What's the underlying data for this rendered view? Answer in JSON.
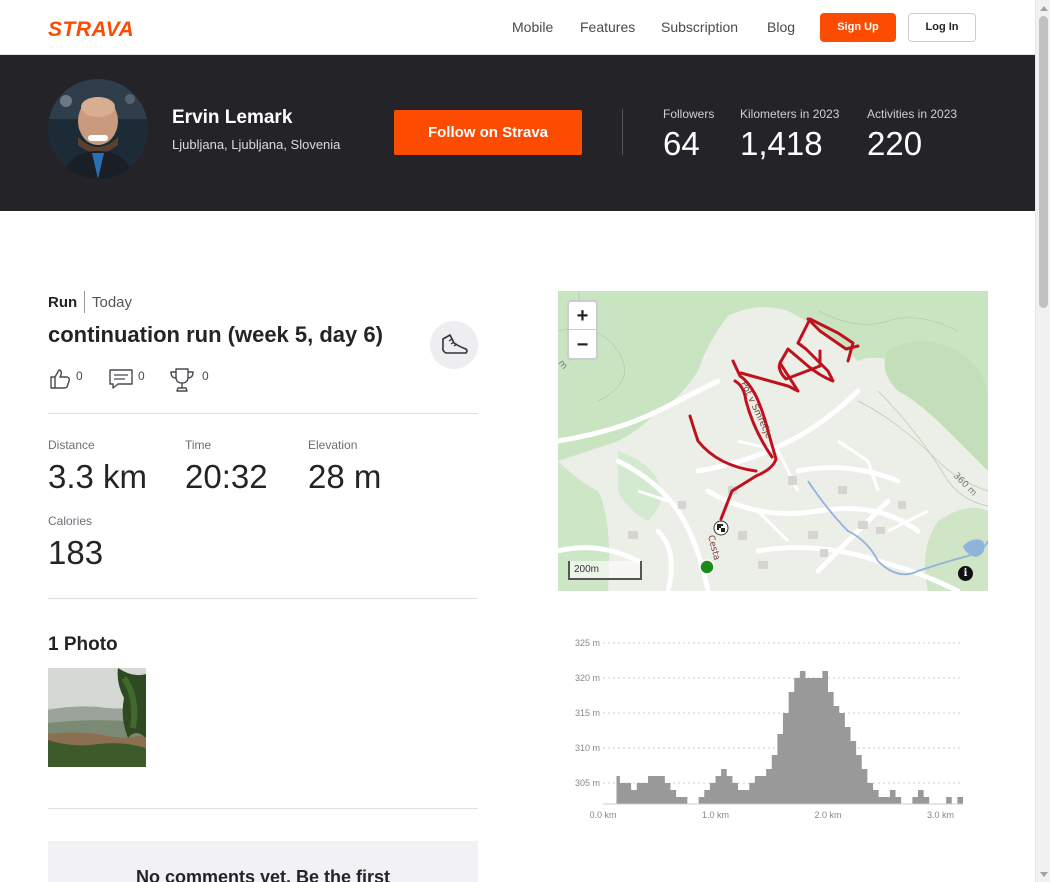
{
  "nav": {
    "logo": "STRAVA",
    "links": [
      "Mobile",
      "Features",
      "Subscription",
      "Blog"
    ],
    "signup": "Sign Up",
    "login": "Log In"
  },
  "athlete": {
    "name": "Ervin Lemark",
    "location": "Ljubljana, Ljubljana, Slovenia",
    "follow_label": "Follow on Strava",
    "stats": [
      {
        "label": "Followers",
        "value": "64"
      },
      {
        "label": "Kilometers in 2023",
        "value": "1,418"
      },
      {
        "label": "Activities in 2023",
        "value": "220"
      }
    ]
  },
  "activity": {
    "type": "Run",
    "date": "Today",
    "title": "continuation run (week 5, day 6)",
    "kudos": "0",
    "comments": "0",
    "achievements": "0",
    "metrics": [
      {
        "label": "Distance",
        "value": "3.3 km"
      },
      {
        "label": "Time",
        "value": "20:32"
      },
      {
        "label": "Elevation",
        "value": "28 m"
      },
      {
        "label": "Calories",
        "value": "183"
      }
    ],
    "photos_heading": "1 Photo",
    "comments_empty": "No comments yet. Be the first"
  },
  "map": {
    "zoom_in": "+",
    "zoom_out": "−",
    "scale": "200m",
    "info": "i",
    "street_labels": [
      "Pot v Smrečje",
      "Cesta"
    ],
    "contour_labels": [
      "360 m",
      "m"
    ],
    "route_color": "#c0111e",
    "start_color": "#1a8a1a"
  },
  "chart_data": {
    "type": "area",
    "title": "",
    "xlabel": "",
    "ylabel": "",
    "y_ticks": [
      "305 m",
      "310 m",
      "315 m",
      "320 m",
      "325 m"
    ],
    "x_ticks": [
      "0.0 km",
      "1.0 km",
      "2.0 km",
      "3.0 km"
    ],
    "xlim": [
      0,
      3.2
    ],
    "ylim": [
      302,
      326
    ],
    "x": [
      0.0,
      0.1,
      0.12,
      0.15,
      0.2,
      0.25,
      0.3,
      0.35,
      0.4,
      0.45,
      0.5,
      0.55,
      0.6,
      0.65,
      0.7,
      0.75,
      0.8,
      0.85,
      0.9,
      0.95,
      1.0,
      1.05,
      1.1,
      1.15,
      1.2,
      1.25,
      1.3,
      1.35,
      1.4,
      1.45,
      1.5,
      1.55,
      1.6,
      1.65,
      1.7,
      1.75,
      1.8,
      1.85,
      1.9,
      1.95,
      2.0,
      2.05,
      2.1,
      2.15,
      2.2,
      2.25,
      2.3,
      2.35,
      2.4,
      2.45,
      2.5,
      2.55,
      2.6,
      2.65,
      2.7,
      2.75,
      2.8,
      2.85,
      2.9,
      2.95,
      3.0,
      3.05,
      3.1,
      3.15,
      3.2
    ],
    "y": [
      302,
      302,
      306,
      305,
      305,
      304,
      305,
      305,
      306,
      306,
      306,
      305,
      304,
      303,
      303,
      302,
      302,
      303,
      304,
      305,
      306,
      307,
      306,
      305,
      304,
      304,
      305,
      306,
      306,
      307,
      309,
      312,
      315,
      318,
      320,
      321,
      320,
      320,
      320,
      321,
      318,
      316,
      315,
      313,
      311,
      309,
      307,
      305,
      304,
      303,
      303,
      304,
      303,
      302,
      302,
      303,
      304,
      303,
      302,
      302,
      302,
      303,
      302,
      303,
      304
    ],
    "fill_color": "#999999"
  }
}
